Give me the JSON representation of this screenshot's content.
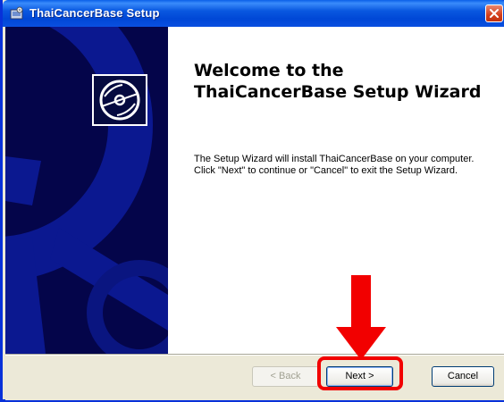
{
  "window": {
    "title": "ThaiCancerBase Setup"
  },
  "main": {
    "heading_line1": "Welcome to the",
    "heading_line2": "ThaiCancerBase Setup Wizard",
    "description": "The Setup Wizard will install ThaiCancerBase on your computer.  Click \"Next\" to continue or \"Cancel\" to exit the Setup Wizard."
  },
  "buttons": {
    "back": "< Back",
    "next": "Next >",
    "cancel": "Cancel"
  },
  "colors": {
    "titlebar": "#0a58e0",
    "banner": "#04054a",
    "annotation": "#f20000"
  },
  "icons": {
    "app": "installer-icon",
    "disc": "cd-disc-icon",
    "close": "close-icon"
  }
}
